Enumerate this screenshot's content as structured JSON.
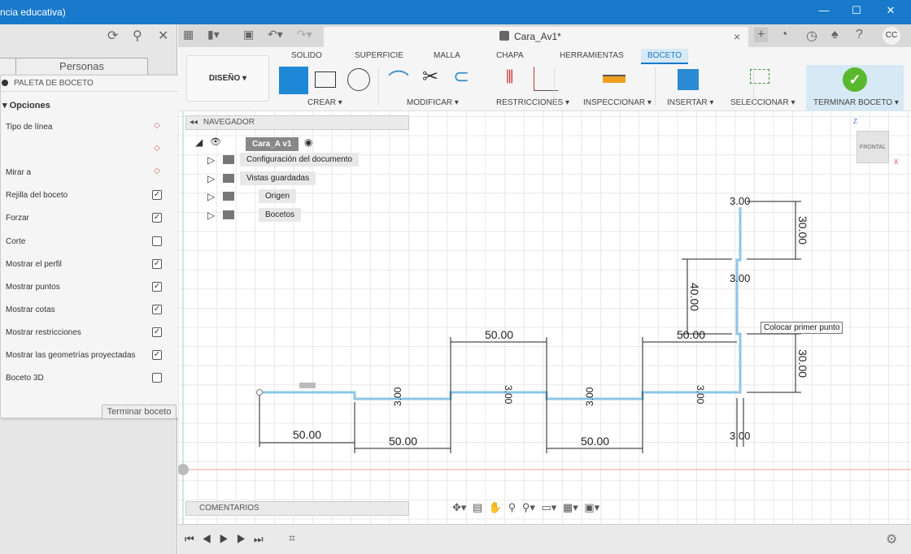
{
  "window": {
    "title": "ncia educativa)",
    "min": "—",
    "max": "☐",
    "close": "✕"
  },
  "left": {
    "tabs": [
      "",
      "Personas"
    ],
    "palette_title": "PALETA DE BOCETO",
    "section": "▾ Opciones",
    "options": [
      {
        "label": "Tipo de línea",
        "type": "icon"
      },
      {
        "label": "",
        "type": "icon"
      },
      {
        "label": "Mirar a",
        "type": "icon"
      },
      {
        "label": "Rejilla del boceto",
        "checked": true
      },
      {
        "label": "Forzar",
        "checked": true
      },
      {
        "label": "Corte",
        "checked": false
      },
      {
        "label": "Mostrar el perfil",
        "checked": true
      },
      {
        "label": "Mostrar puntos",
        "checked": true
      },
      {
        "label": "Mostrar cotas",
        "checked": true
      },
      {
        "label": "Mostrar restricciones",
        "checked": true
      },
      {
        "label": "Mostrar las geometrías proyectadas",
        "checked": true
      },
      {
        "label": "Boceto 3D",
        "checked": false
      }
    ],
    "finish": "Terminar boceto"
  },
  "doc": {
    "title": "Cara_Av1*",
    "close": "×",
    "user": "CC"
  },
  "ribbon": {
    "workspace": "DISEÑO ▾",
    "tabs": [
      "SOLIDO",
      "SUPERFICIE",
      "MALLA",
      "CHAPA",
      "HERRAMIENTAS",
      "BOCETO"
    ],
    "active_tab": "BOCETO",
    "groups": [
      "CREAR ▾",
      "MODIFICAR ▾",
      "RESTRICCIONES ▾",
      "INSPECCIONAR ▾",
      "INSERTAR ▾",
      "SELECCIONAR ▾",
      "TERMINAR BOCETO ▾"
    ]
  },
  "navigator": {
    "title": "NAVEGADOR",
    "root": "Cara_A v1",
    "items": [
      "Configuración del documento",
      "Vistas guardadas",
      "Origen",
      "Bocetos"
    ]
  },
  "comments": "COMENTARIOS",
  "viewcube": {
    "face": "FRONTAL",
    "z": "Z",
    "x": "X"
  },
  "sketch": {
    "dims": [
      "50.00",
      "50.00",
      "50.00",
      "50.00",
      "50.00",
      "30.00",
      "40.00",
      "30.00",
      "3.00",
      "3.00",
      "3.00",
      "3.00",
      "3.00",
      "3.00",
      "3.00"
    ],
    "tooltip": "Colocar primer punto"
  },
  "colors": {
    "accent": "#1979ca",
    "profile": "#8ec6e6",
    "confirm": "#5ab82e"
  }
}
